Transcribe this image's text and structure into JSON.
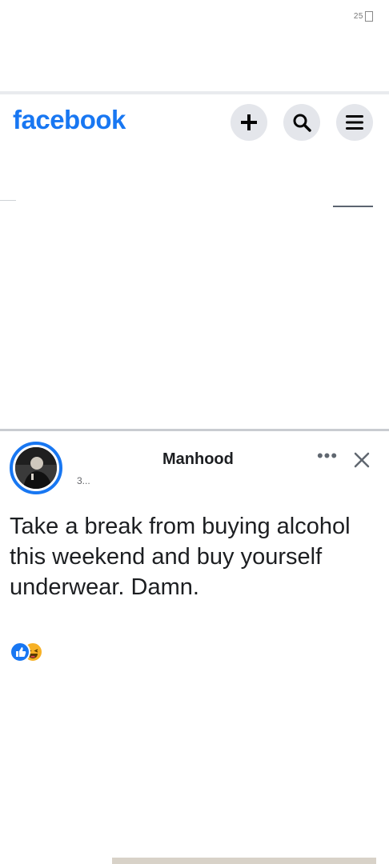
{
  "app": {
    "logo_text": "facebook",
    "brand_color": "#1877f2"
  },
  "status_bar": {
    "battery_text": "25"
  },
  "header": {
    "buttons": [
      {
        "name": "create-button",
        "icon": "plus-icon"
      },
      {
        "name": "search-button",
        "icon": "search-icon"
      },
      {
        "name": "menu-button",
        "icon": "hamburger-icon"
      }
    ]
  },
  "post": {
    "author": "Manhood",
    "meta": "3...",
    "more_label": "•••",
    "close_icon": "close-icon",
    "text": "Take a break from buying alcohol this weekend and buy yourself underwear. Damn.",
    "reactions": [
      {
        "type": "like",
        "icon": "like-icon",
        "color": "#1877f2"
      },
      {
        "type": "haha",
        "icon": "haha-icon",
        "color": "#f7b125"
      }
    ]
  }
}
